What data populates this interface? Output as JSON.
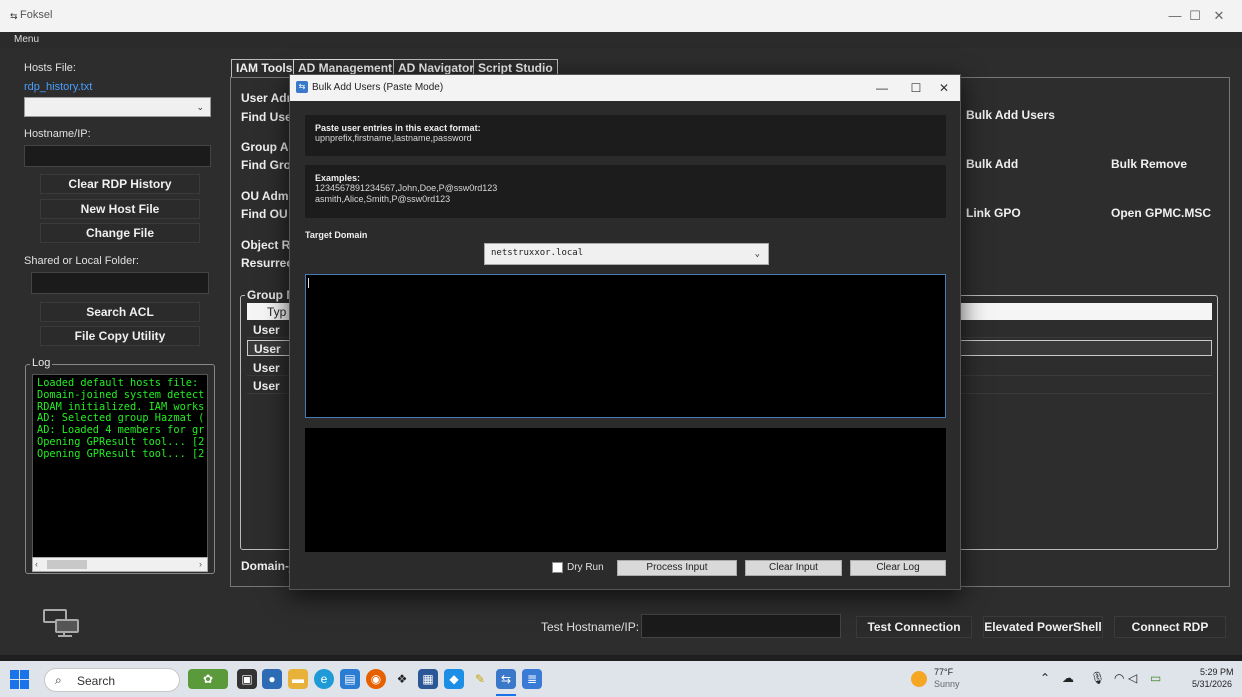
{
  "window": {
    "title": "Foksel",
    "minimize": "—",
    "maximize": "☐",
    "close": "✕"
  },
  "menu": {
    "label": "Menu"
  },
  "left": {
    "hosts_file_label": "Hosts File:",
    "hosts_file_link": "rdp_history.txt",
    "hostname_label": "Hostname/IP:",
    "clear_rdp": "Clear RDP History",
    "new_host_file": "New Host File",
    "change_file": "Change File",
    "shared_folder_label": "Shared or Local Folder:",
    "search_acl": "Search ACL",
    "file_copy": "File Copy Utility",
    "log_label": "Log",
    "log_lines": "Loaded default hosts file:\nDomain-joined system detect\nRDAM initialized. IAM works\nAD: Selected group Hazmat (\nAD: Loaded 4 members for gr\nOpening GPResult tool... [2\nOpening GPResult tool... [2"
  },
  "tabs": [
    "IAM Tools",
    "AD Management",
    "AD Navigator",
    "Script Studio"
  ],
  "admgmt": {
    "user_adm": "User Adm",
    "find_user": "Find User",
    "group_ac": "Group Ac",
    "find_grou": "Find Grou",
    "ou_admi": "OU Admi",
    "find_ou": "Find OU",
    "object_re": "Object Re",
    "resurrect": "Resurrect",
    "bulk_add_users": "Bulk Add Users",
    "bulk_add": "Bulk Add",
    "bulk_remove": "Bulk Remove",
    "link_gpo": "Link GPO",
    "open_gpmc": "Open GPMC.MSC",
    "group_legend": "Group M",
    "grid_header": "Typ",
    "rows": [
      "User",
      "User",
      "User",
      "User"
    ],
    "domain_status": "Domain-j"
  },
  "bottom": {
    "test_host_label": "Test Hostname/IP:",
    "test_connection": "Test Connection",
    "elevated_ps": "Elevated PowerShell",
    "connect_rdp": "Connect RDP"
  },
  "dialog": {
    "title": "Bulk Add Users (Paste Mode)",
    "format_heading": "Paste user entries in this exact format:",
    "format_text": "upnprefix,firstname,lastname,password",
    "examples_heading": "Examples:",
    "example1": "1234567891234567,John,Doe,P@ssw0rd123",
    "example2": "asmith,Alice,Smith,P@ssw0rd123",
    "target_domain_label": "Target Domain",
    "target_domain_value": "netstruxxor.local",
    "dry_run": "Dry Run",
    "process_input": "Process Input",
    "clear_input": "Clear Input",
    "clear_log": "Clear Log"
  },
  "taskbar": {
    "search": "Search",
    "weather_temp": "77°F",
    "weather_cond": "Sunny",
    "time": "5:29 PM",
    "date": "5/31/2026"
  },
  "colors": {
    "log_text": "#22ee22",
    "link": "#4a9eff",
    "accent": "#1a73e8"
  }
}
